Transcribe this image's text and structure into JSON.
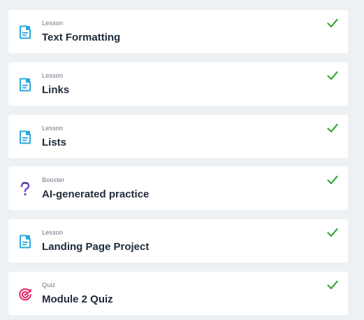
{
  "items": [
    {
      "kind": "Lesson",
      "title": "Text Formatting",
      "icon": "lesson-document-icon",
      "status": "completed"
    },
    {
      "kind": "Lesson",
      "title": "Links",
      "icon": "lesson-document-icon",
      "status": "completed"
    },
    {
      "kind": "Lesson",
      "title": "Lists",
      "icon": "lesson-document-icon",
      "status": "completed"
    },
    {
      "kind": "Booster",
      "title": "AI-generated practice",
      "icon": "question-mark-icon",
      "status": "completed"
    },
    {
      "kind": "Lesson",
      "title": "Landing Page Project",
      "icon": "lesson-document-icon",
      "status": "completed"
    },
    {
      "kind": "Quiz",
      "title": "Module 2 Quiz",
      "icon": "target-icon",
      "status": "completed"
    }
  ],
  "colors": {
    "background": "#eef1f4",
    "card": "#ffffff",
    "lesson_icon": "#2aa8e0",
    "booster_icon": "#7b4fd6",
    "quiz_icon": "#e0245e",
    "check": "#3aa935",
    "title": "#1f2a3a",
    "kind": "#6b7280"
  }
}
